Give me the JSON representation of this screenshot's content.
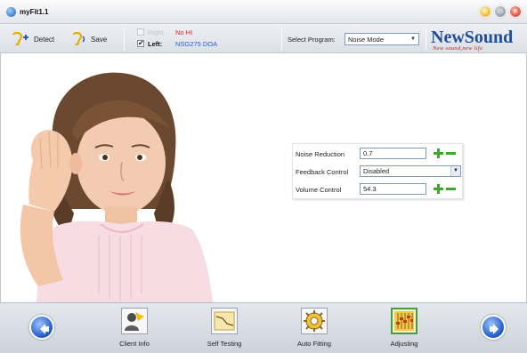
{
  "window": {
    "title": "myFit1.1",
    "app_icon": "app-globe-icon"
  },
  "toolbar": {
    "detect_label": "Detect",
    "save_label": "Save",
    "right_ear_label": "Right",
    "right_ear_value": "No HI",
    "right_ear_checked": false,
    "left_ear_label": "Left:",
    "left_ear_value": "NSG275 DOA",
    "left_ear_checked": true,
    "program_label": "Select Program:",
    "program_value": "Noise Mode"
  },
  "brand": {
    "name": "NewSound",
    "tagline": "New sound,new life"
  },
  "settings": {
    "noise_reduction_label": "Noise Reduction",
    "noise_reduction_value": "0.7",
    "feedback_control_label": "Feedback Control",
    "feedback_control_value": "Disabled",
    "volume_control_label": "Volume Control",
    "volume_control_value": "54.3"
  },
  "bottom_nav": {
    "items": [
      {
        "label": "Client Info",
        "icon": "client-info-icon",
        "active": false
      },
      {
        "label": "Self Testing",
        "icon": "self-testing-icon",
        "active": false
      },
      {
        "label": "Auto Fitting",
        "icon": "auto-fitting-icon",
        "active": false
      },
      {
        "label": "Adjusting",
        "icon": "adjusting-icon",
        "active": true
      }
    ]
  },
  "colors": {
    "brand_blue": "#1f4f9a",
    "brand_red": "#b4241f",
    "warning_red": "#e0201e",
    "device_blue": "#1e5fd8",
    "adjust_green": "#3caa2d"
  }
}
